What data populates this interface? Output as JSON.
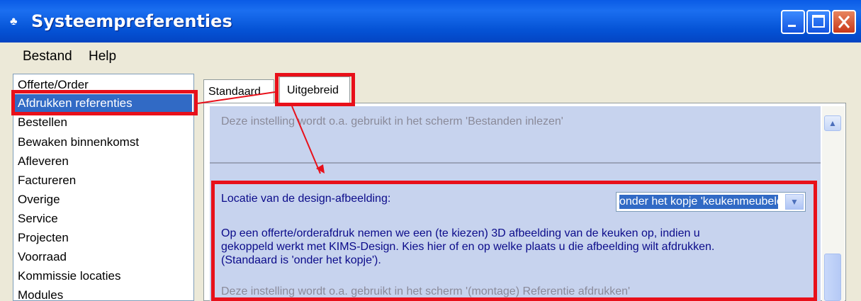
{
  "window": {
    "title": "Systeempreferenties",
    "app_icon": "app-icon"
  },
  "menu": {
    "items": [
      "Bestand",
      "Help"
    ]
  },
  "sidebar": {
    "items": [
      {
        "label": "Offerte/Order"
      },
      {
        "label": "Afdrukken referenties",
        "selected": true
      },
      {
        "label": "Bestellen"
      },
      {
        "label": "Bewaken binnenkomst"
      },
      {
        "label": "Afleveren"
      },
      {
        "label": "Factureren"
      },
      {
        "label": "Overige"
      },
      {
        "label": "Service"
      },
      {
        "label": "Projecten"
      },
      {
        "label": "Voorraad"
      },
      {
        "label": "Kommissie locaties"
      },
      {
        "label": "Modules"
      }
    ]
  },
  "tabs": [
    {
      "label": "Standaard"
    },
    {
      "label": "Uitgebreid",
      "active": true
    }
  ],
  "content": {
    "hint_top": "Deze instelling wordt o.a. gebruikt in het scherm 'Bestanden inlezen'",
    "setting_label": "Locatie van de design-afbeelding:",
    "select_value": "onder het kopje 'keukenmeubelen'",
    "description_lines": [
      "Op een offerte/orderafdruk nemen we een (te kiezen) 3D afbeelding van de keuken op, indien u",
      "gekoppeld werkt met KIMS-Design. Kies hier of en op welke plaats u die afbeelding wilt afdrukken.",
      "(Standaard is 'onder het kopje')."
    ],
    "hint_bottom": "Deze instelling wordt o.a. gebruikt in het scherm '(montage) Referentie afdrukken'"
  },
  "colors": {
    "titlebar": "#0553D6",
    "selection": "#316AC5",
    "highlight_box": "#E8101A",
    "panel": "#C7D3EE"
  }
}
